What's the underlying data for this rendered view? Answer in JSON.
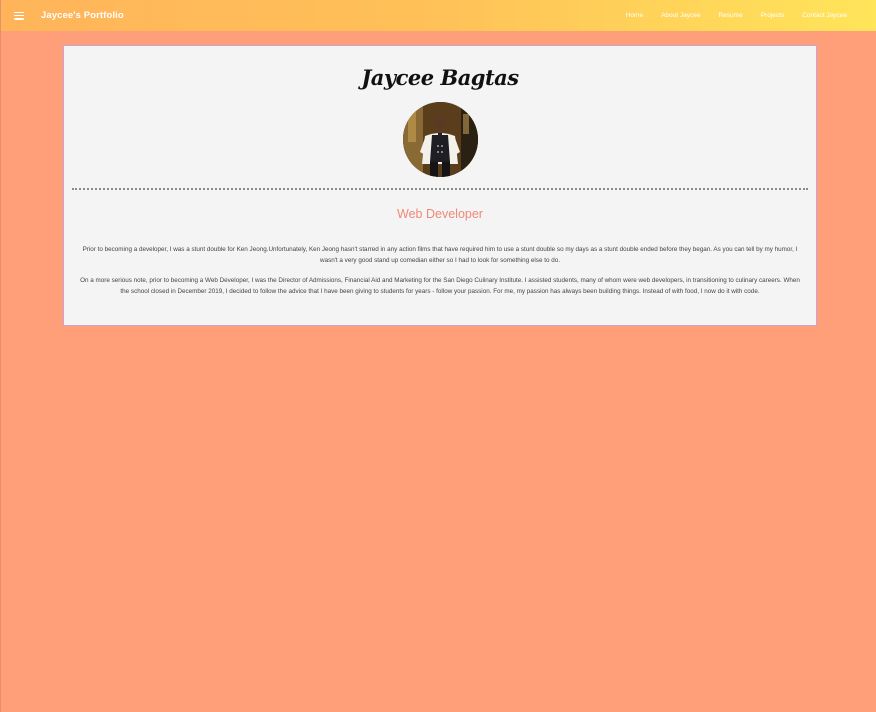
{
  "navbar": {
    "brand": "Jaycee's Portfolio",
    "links": [
      "Home",
      "About Jaycee",
      "Resume",
      "Projects",
      "Contact Jaycee"
    ]
  },
  "profile": {
    "name": "Jaycee Bagtas",
    "role": "Web Developer",
    "paragraphs": [
      "Prior to becoming a developer, I was a stunt double for Ken Jeong.Unfortunately, Ken Jeong hasn't starred in any action films that have required him to use a stunt double so my days as a stunt double ended before they began. As you can tell by my humor, I wasn't a very good stand up comedian either so I had to look for something else to do.",
      "On a more serious note, prior to becoming a Web Developer, I was the Director of Admissions, Financial Aid and Marketing for the San Diego Culinary Institute. I assisted students, many of whom were web developers, in transitioning to culinary careers. When the school closed in December 2019, I decided to follow the advice that I have been giving to students for years - follow your passion. For me, my passion has always been building things. Instead of with food, I now do it with code."
    ]
  },
  "colors": {
    "background": "#ff9f7a",
    "navbar_gradient_start": "#ffb45a",
    "navbar_gradient_end": "#ffe55a",
    "card_background": "#f4f4f4",
    "role_text": "#f08878"
  },
  "icons": {
    "menu": "hamburger-menu-icon"
  }
}
